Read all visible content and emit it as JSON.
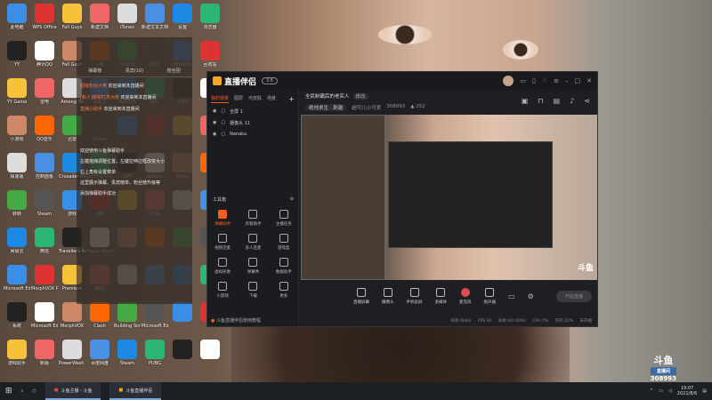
{
  "desktop": {
    "icons": [
      "此电脑",
      "WPS Office",
      "Fall Guys",
      "新建文档",
      "iTunes",
      "新建文本文档",
      "设置",
      "浏览器",
      "YY",
      "腾讯QQ",
      "Fall Guys",
      "斗鱼",
      "QQ管家",
      "游戏",
      "游戏助手",
      "回收站",
      "YY Game",
      "雷电",
      "Among Us",
      "网易云",
      "腾讯视频",
      "图片",
      "OBS",
      "",
      "小游戏",
      "QQ音乐",
      "迅雷",
      "Steam",
      "",
      "",
      "",
      "",
      "极速版",
      "控制面板",
      "Crusader Kings",
      "Getting Over It",
      "回声",
      "Nakaka",
      "Meta",
      "",
      "转转",
      "Steam",
      "游戏",
      "剪映",
      "",
      "PUBG",
      "",
      "",
      "网易云",
      "微信",
      "Travellers Rest",
      "Poppy Playtime",
      "",
      "",
      "",
      "",
      "Microsoft Edge",
      "MorphVOX Pro",
      "Premiere",
      "截图",
      "",
      "",
      "",
      "",
      "系统",
      "Microsoft Edge",
      "MorphVOX",
      "Clash",
      "Building Simulator",
      "Microsoft Edge",
      "",
      "",
      "游戏助手",
      "新版",
      "PowerWash Simulator",
      "百度网盘",
      "Steam",
      "PUBG",
      "",
      ""
    ]
  },
  "chat": {
    "tabs": [
      "弹幕榜",
      "贵宾(10)",
      "粉丝团"
    ],
    "messages": [
      {
        "user": "超级粉丝大佬",
        "text": "欢迎来到本直播间"
      },
      {
        "user": "[新人]谢谢打赏大佬",
        "text": "欢迎来到本直播间"
      },
      {
        "user": "直播小助手",
        "text": "欢迎来到本直播间"
      }
    ],
    "system": [
      "欢迎使用斗鱼弹幕助手",
      "左键拖拽调整位置，左键拉伸边框改变大小",
      "右上角有设置菜单",
      "这里展示弹幕、贵宾榜单，粉丝榜升级等",
      "添加弹幕助手成功"
    ]
  },
  "app": {
    "title": "直播伴侣",
    "version": "3.6",
    "sidebar": {
      "tabs": [
        "我的场景",
        "图层",
        "可皮肤",
        "场景"
      ],
      "scenes": [
        "全屏 1",
        "摄像头 11",
        "Nanaka"
      ],
      "toolbox_title": "工具箱",
      "tools": [
        "弹幕助手",
        "房管助手",
        "主播任务",
        "视频连麦",
        "多人连麦",
        "游戏盒",
        "虚拟形象",
        "弹幕秀",
        "数据助手",
        "小游戏",
        "下载",
        "更多"
      ],
      "tip": "斗鱼直播伴侣使用教程"
    },
    "room": {
      "title": "全民制霸后的老实人",
      "tag": "修改",
      "category": "绝地求生 · 刺激",
      "nickname": "超可儿小可爱",
      "room_id": "308993",
      "hot": "252"
    },
    "toolbar": [
      "直播屏幕",
      "摄像头",
      "手机投屏",
      "多媒体",
      "麦克风",
      "扬声器"
    ],
    "start_label": "开始直播",
    "status": [
      "码率:0kb/s",
      "FPS:30",
      "丢帧:0(0.00%)",
      "CPU:7%",
      "内存:22%",
      "未开播"
    ]
  },
  "taskbar": {
    "apps": [
      "斗鱼主播 - 斗鱼",
      "斗鱼直播伴侣"
    ],
    "time": "19:07",
    "date": "2021/8/6"
  },
  "watermark": {
    "brand": "斗鱼",
    "sub": "直播间",
    "room": "308993"
  },
  "colors": {
    "accent": "#ff5a1f",
    "brand": "#f5a623"
  }
}
